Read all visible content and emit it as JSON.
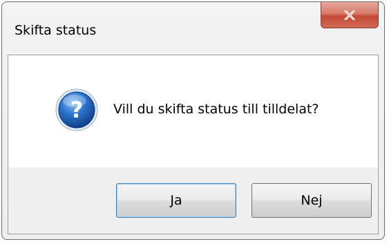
{
  "window": {
    "title": "Skifta status",
    "close_icon": "close-icon"
  },
  "message": {
    "icon": "question-icon",
    "text": "Vill du skifta status till tilldelat?"
  },
  "buttons": {
    "yes_label": "Ja",
    "no_label": "Nej"
  },
  "colors": {
    "close_button": "#c44a35",
    "question_icon": "#1f5fb5",
    "focus_border": "#3c7fb1"
  }
}
